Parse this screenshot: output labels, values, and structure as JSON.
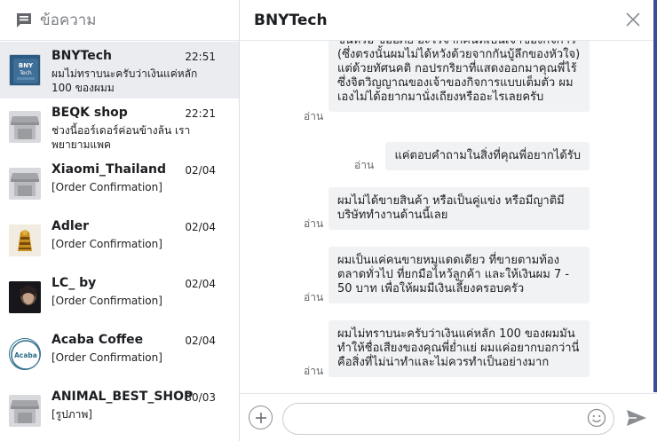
{
  "sidebar": {
    "title": "ข้อความ",
    "conversations": [
      {
        "name": "BNYTech",
        "time": "22:51",
        "preview": "ผมไม่ทราบนะครับว่าเงินแค่หลัก 100 ของผมม",
        "avatar_text": "BNY Tech"
      },
      {
        "name": "BEQK shop",
        "time": "22:21",
        "preview": "ช่วงนี้ออร์เดอร์ค่อนข้างล้น เราพยายามแพค"
      },
      {
        "name": "Xiaomi_Thailand",
        "time": "02/04",
        "preview": "[Order Confirmation]"
      },
      {
        "name": "Adler",
        "time": "02/04",
        "preview": "[Order Confirmation]"
      },
      {
        "name": "LC_ by",
        "time": "02/04",
        "preview": "[Order Confirmation]"
      },
      {
        "name": "Acaba Coffee",
        "time": "02/04",
        "preview": "[Order Confirmation]",
        "avatar_text": "Acaba"
      },
      {
        "name": "ANIMAL_BEST_SHOP",
        "time": "30/03",
        "preview": "[รูปภาพ]"
      }
    ]
  },
  "chat": {
    "title": "BNYTech",
    "read_label": "อ่าน",
    "messages": [
      {
        "text": "ขึ้นหรือ ขออภัย อะไรจากคนที่เป็นเจ้าของกิจการ (ซึ่งตรงนั้นผมไม่ได้หวังด้วยจากกันบู้ลึกของหัวใจ) แต่ด้วยทัศนคติ กอปรกริยาที่แสดงออกมาคุณพี่ไร้ซึ่งจิตวิญญาณของเจ้าของกิจการแบบเต็มตัว ผมเองไม่ได้อยากมานั่งเถียงหรืออะไรเลยครับ"
      },
      {
        "text": "แค่ตอบคำถามในสิ่งที่คุณพี่อยากได้รับ"
      },
      {
        "text": "ผมไม่ได้ขายสินค้า หรือเป็นคู่แข่ง หรือมีญาติมีบริษัททำงานด้านนี้เลย"
      },
      {
        "text": "ผมเป็นแค่คนขายหมูแดดเดียว ที่ขายตามท้องตลาดทั่วไป ที่ยกมือไหว้ลูกค้า และให้เงินผม 7 - 50 บาท เพื่อให้ผมมีเงินเลี้ยงครอบครัว"
      },
      {
        "text": "ผมไม่ทราบนะครับว่าเงินแค่หลัก 100 ของผมมันทำให้ชื่อเสียงของคุณพี่ย่ำแย่ ผมแค่อยากบอกว่านี่คือสิ่งที่ไม่น่าทำและไม่ควรทำเป็นอย่างมาก"
      }
    ]
  },
  "composer": {
    "placeholder": ""
  },
  "colors": {
    "active_row": "#eaecef",
    "bubble": "#f1f2f4",
    "scrollbar": "#3b4a9a",
    "send": "#8a8d91"
  }
}
